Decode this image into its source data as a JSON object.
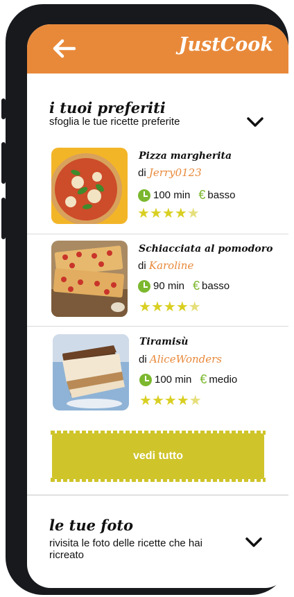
{
  "app": {
    "brand": "JustCook"
  },
  "favorites": {
    "title": "i tuoi preferiti",
    "subtitle": "sfoglia le tue ricette preferite",
    "see_all_label": "vedi tutto",
    "recipes": [
      {
        "title": "Pizza margherita",
        "by": "di",
        "author": "Jerry0123",
        "time": "100 min",
        "cost": "basso",
        "rating": 4.5
      },
      {
        "title": "Schiacciata al pomodoro",
        "by": "di",
        "author": "Karoline",
        "time": "90 min",
        "cost": "basso",
        "rating": 4.5
      },
      {
        "title": "Tiramisù",
        "by": "di",
        "author": "AliceWonders",
        "time": "100 min",
        "cost": "medio",
        "rating": 4.5
      }
    ]
  },
  "photos": {
    "title": "le tue foto",
    "subtitle": "rivisita le foto delle ricette che hai ricreato"
  },
  "colors": {
    "header": "#e8893a",
    "accent_green": "#7cb82f",
    "star": "#d9cf22",
    "button": "#cfc42a"
  }
}
